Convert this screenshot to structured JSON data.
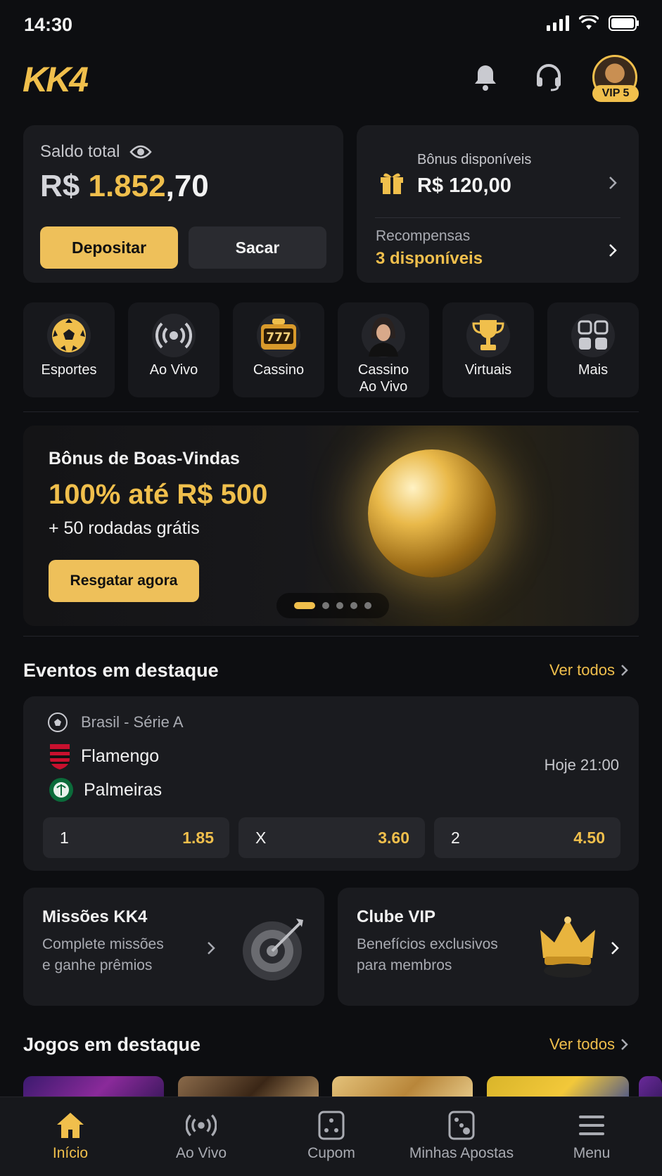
{
  "status": {
    "time": "14:30"
  },
  "header": {
    "logo": "KK4",
    "vip_badge": "VIP 5"
  },
  "balance": {
    "label": "Saldo total",
    "currency": "R$ ",
    "amount_main": "1.852",
    "amount_cents": ",70",
    "deposit_label": "Depositar",
    "withdraw_label": "Sacar"
  },
  "bonus": {
    "label": "Bônus disponíveis",
    "amount": "R$ 120,00",
    "rewards_label": "Recompensas",
    "rewards_value": "3 disponíveis"
  },
  "categories": [
    {
      "label": "Esportes",
      "icon": "soccer-ball-icon"
    },
    {
      "label": "Ao Vivo",
      "icon": "live-icon"
    },
    {
      "label": "Cassino",
      "icon": "slot-machine-icon"
    },
    {
      "label": "Cassino\nAo Vivo",
      "icon": "dealer-icon"
    },
    {
      "label": "Virtuais",
      "icon": "trophy-icon"
    },
    {
      "label": "Mais",
      "icon": "grid-icon"
    }
  ],
  "banner": {
    "title": "Bônus de Boas-Vindas",
    "headline": "100% até R$ 500",
    "subline": "+ 50 rodadas grátis",
    "cta": "Resgatar agora",
    "active_slide": 1,
    "slide_count": 5
  },
  "events": {
    "title": "Eventos em destaque",
    "see_all": "Ver todos",
    "league": "Brasil - Série A",
    "home": "Flamengo",
    "away": "Palmeiras",
    "time": "Hoje 21:00",
    "odds": [
      {
        "label": "1",
        "value": "1.85"
      },
      {
        "label": "X",
        "value": "3.60"
      },
      {
        "label": "2",
        "value": "4.50"
      }
    ]
  },
  "promos": {
    "missions": {
      "title": "Missões KK4",
      "desc1": "Complete missões",
      "desc2": "e ganhe prêmios"
    },
    "vip": {
      "title": "Clube VIP",
      "desc1": "Benefícios exclusivos",
      "desc2": "para membros"
    }
  },
  "games": {
    "title": "Jogos em destaque",
    "see_all": "Ver todos"
  },
  "tabbar": [
    {
      "label": "Início",
      "icon": "home-icon",
      "active": true
    },
    {
      "label": "Ao Vivo",
      "icon": "live-icon"
    },
    {
      "label": "Cupom",
      "icon": "coupon-icon"
    },
    {
      "label": "Minhas Apostas",
      "icon": "bets-icon"
    },
    {
      "label": "Menu",
      "icon": "menu-icon"
    }
  ],
  "colors": {
    "accent": "#f0bf4c",
    "bg": "#0d0e11",
    "card": "#1a1b1f"
  }
}
